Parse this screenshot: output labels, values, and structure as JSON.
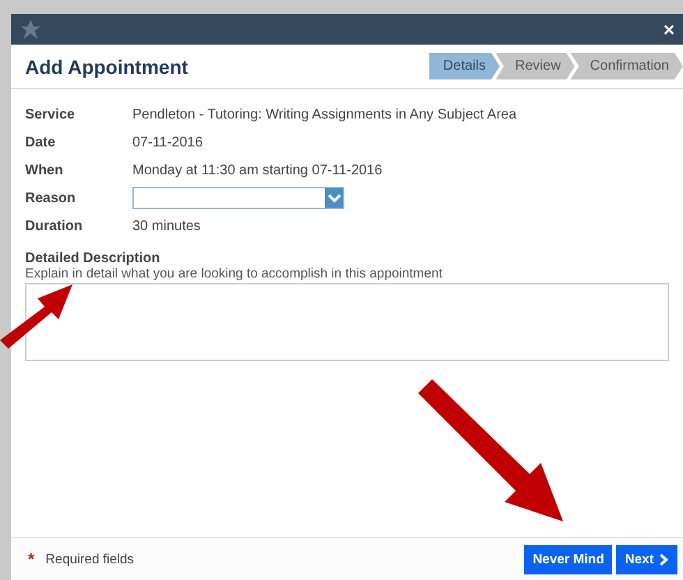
{
  "dialog": {
    "title": "Add Appointment",
    "close": "×"
  },
  "steps": [
    {
      "label": "Details",
      "selected": true
    },
    {
      "label": "Review",
      "selected": false
    },
    {
      "label": "Confirmation",
      "selected": false
    }
  ],
  "fields": [
    {
      "kind": "text",
      "label": "Service",
      "value": "Pendleton - Tutoring: Writing Assignments in Any Subject Area"
    },
    {
      "kind": "text",
      "label": "Date",
      "value": "07-11-2016"
    },
    {
      "kind": "text",
      "label": "When",
      "value": "Monday at 11:30 am starting 07-11-2016"
    },
    {
      "kind": "select",
      "label": "Reason"
    },
    {
      "kind": "text",
      "label": "Duration",
      "value": "30 minutes"
    }
  ],
  "description": {
    "label": "Detailed Description",
    "hint": "Explain in detail what you are looking to accomplish in this appointment"
  },
  "footer": {
    "required_mark": "*",
    "required_text": "Required fields",
    "buttons": [
      {
        "label": "Never Mind",
        "kind": "plain"
      },
      {
        "label": "Next",
        "kind": "next"
      }
    ]
  }
}
